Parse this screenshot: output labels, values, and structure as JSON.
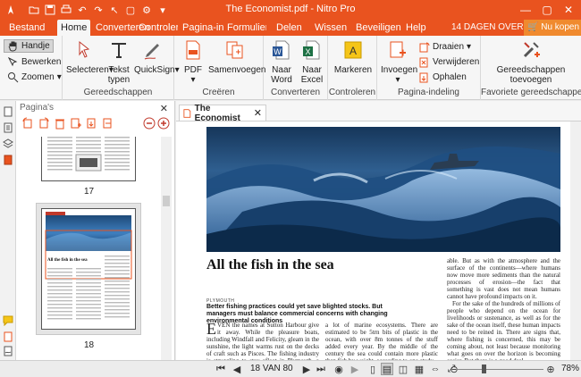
{
  "window": {
    "title": "The Economist.pdf - Nitro Pro"
  },
  "menu": {
    "file_tab": "Bestand",
    "tabs": [
      "Home",
      "Converteren",
      "Controleren",
      "Pagina-indeling",
      "Formulieren",
      "Delen",
      "Wissen",
      "Beveiligen",
      "Help"
    ],
    "trial_text": "14 DAGEN OVER",
    "buy_label": "Nu kopen"
  },
  "ribbon": {
    "modes": {
      "hand": "Handje",
      "edit": "Bewerken",
      "zoom": "Zoomen"
    },
    "tools": {
      "select": "Selecteren",
      "text": "Tekst typen",
      "quicksign": "QuickSign",
      "group": "Gereedschappen"
    },
    "create": {
      "pdf": "PDF",
      "merge": "Samenvoegen",
      "group": "Creëren"
    },
    "convert": {
      "word": "Naar Word",
      "excel": "Naar Excel",
      "group": "Converteren"
    },
    "review": {
      "highlight": "Markeren",
      "group": "Controleren"
    },
    "layout": {
      "insert": "Invoegen",
      "rotate": "Draaien",
      "delete": "Verwijderen",
      "extract": "Ophalen",
      "group": "Pagina-indeling"
    },
    "favorites": {
      "tools": "Gereedschappen toevoegen",
      "group": "Favoriete gereedschappen"
    }
  },
  "pages_panel": {
    "title": "Pagina's",
    "thumbnails": [
      {
        "label": "17"
      },
      {
        "label": "18"
      }
    ],
    "thumb18_headline": "All the fish in the sea"
  },
  "document": {
    "tab_label": "The Economist",
    "headline": "All the fish in the sea",
    "kicker": "PLYMOUTH",
    "standfirst": "Better fishing practices could yet save blighted stocks. But managers must balance commercial concerns with changing environmental conditions",
    "col1_dropcap": "E",
    "col1_text": "VEN the names at Sutton Harbour give it away. While the pleasure boats, including Windfall and Felicity, gleam in the sunshine, the light warms rust on the decks of craft such as Pisces. The fishing industry is struggling to stay afloat in Plymouth, a port",
    "col2_text": "a lot of marine ecosystems. There are estimated to be 5trn bits of plastic in the ocean, with over 8m tonnes of the stuff added every year. By the middle of the century the sea could contain more plastic than fish by weight, according to one study",
    "col3_p1": "able. But as with the atmosphere and the surface of the continents—where humans now move more sediments than the natural processes of erosion—the fact that something is vast does not mean humans cannot have profound impacts on it.",
    "col3_p2": "For the sake of the hundreds of millions of people who depend on the ocean for livelihoods or sustenance, as well as for the sake of the ocean itself, these human impacts need to be reined in. There are signs that, where fishing is concerned, this may be coming about, not least because monitoring what goes on over the horizon is becoming easier. But there is a good deal"
  },
  "status": {
    "page_indicator": "18 VAN 80",
    "zoom_percent": "78%",
    "zoom_level": 0.3
  },
  "colors": {
    "brand": "#e9531f",
    "accent": "#f08a2e"
  }
}
